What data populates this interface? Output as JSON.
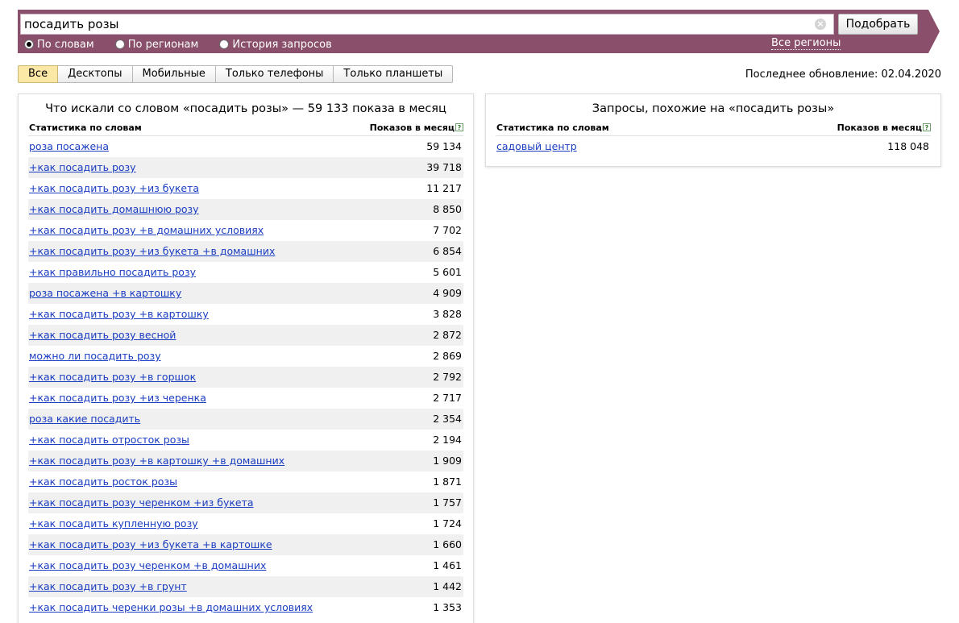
{
  "search": {
    "query": "посадить розы",
    "clear_icon": "close-icon",
    "button_label": "Подобрать"
  },
  "modes": [
    {
      "label": "По словам",
      "checked": true
    },
    {
      "label": "По регионам",
      "checked": false
    },
    {
      "label": "История запросов",
      "checked": false
    }
  ],
  "regions_link": "Все регионы",
  "tabs": [
    {
      "label": "Все",
      "active": true
    },
    {
      "label": "Десктопы",
      "active": false
    },
    {
      "label": "Мобильные",
      "active": false
    },
    {
      "label": "Только телефоны",
      "active": false
    },
    {
      "label": "Только планшеты",
      "active": false
    }
  ],
  "last_update": "Последнее обновление: 02.04.2020",
  "left_panel": {
    "title": "Что искали со словом «посадить розы» — 59 133 показа в месяц",
    "col_keyword": "Статистика по словам",
    "col_count": "Показов в месяц",
    "help_icon": "?",
    "rows": [
      {
        "keyword": "роза посажена",
        "count": "59 134"
      },
      {
        "keyword": "+как посадить розу",
        "count": "39 718"
      },
      {
        "keyword": "+как посадить розу +из букета",
        "count": "11 217"
      },
      {
        "keyword": "+как посадить домашнюю розу",
        "count": "8 850"
      },
      {
        "keyword": "+как посадить розу +в домашних условиях",
        "count": "7 702"
      },
      {
        "keyword": "+как посадить розу +из букета +в домашних",
        "count": "6 854"
      },
      {
        "keyword": "+как правильно посадить розу",
        "count": "5 601"
      },
      {
        "keyword": "роза посажена +в картошку",
        "count": "4 909"
      },
      {
        "keyword": "+как посадить розу +в картошку",
        "count": "3 828"
      },
      {
        "keyword": "+как посадить розу весной",
        "count": "2 872"
      },
      {
        "keyword": "можно ли посадить розу",
        "count": "2 869"
      },
      {
        "keyword": "+как посадить розу +в горшок",
        "count": "2 792"
      },
      {
        "keyword": "+как посадить розу +из черенка",
        "count": "2 717"
      },
      {
        "keyword": "роза какие посадить",
        "count": "2 354"
      },
      {
        "keyword": "+как посадить отросток розы",
        "count": "2 194"
      },
      {
        "keyword": "+как посадить розу +в картошку +в домашних",
        "count": "1 909"
      },
      {
        "keyword": "+как посадить росток розы",
        "count": "1 871"
      },
      {
        "keyword": "+как посадить розу черенком +из букета",
        "count": "1 757"
      },
      {
        "keyword": "+как посадить купленную розу",
        "count": "1 724"
      },
      {
        "keyword": "+как посадить розу +из букета +в картошке",
        "count": "1 660"
      },
      {
        "keyword": "+как посадить розу черенком +в домашних",
        "count": "1 461"
      },
      {
        "keyword": "+как посадить розу +в грунт",
        "count": "1 442"
      },
      {
        "keyword": "+как посадить черенки розы +в домашних условиях",
        "count": "1 353"
      }
    ]
  },
  "right_panel": {
    "title": "Запросы, похожие на «посадить розы»",
    "col_keyword": "Статистика по словам",
    "col_count": "Показов в месяц",
    "help_icon": "?",
    "rows": [
      {
        "keyword": "садовый центр",
        "count": "118 048"
      }
    ]
  }
}
